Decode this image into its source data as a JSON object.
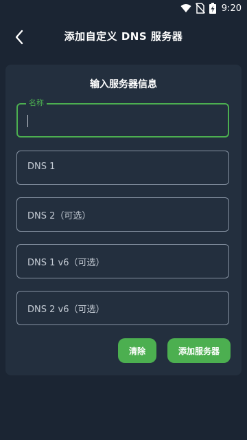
{
  "status_bar": {
    "time": "9:20",
    "icons": [
      "wifi-icon",
      "no-sim-icon",
      "battery-charging-icon"
    ]
  },
  "app_bar": {
    "title": "添加自定义 DNS 服务器",
    "back_icon": "back-arrow-icon"
  },
  "form": {
    "title": "输入服务器信息",
    "name_field": {
      "label": "名称",
      "value": ""
    },
    "dns1_field": {
      "placeholder": "DNS 1"
    },
    "dns2_field": {
      "placeholder": "DNS 2（可选）"
    },
    "dns1v6_field": {
      "placeholder": "DNS 1 v6（可选）"
    },
    "dns2v6_field": {
      "placeholder": "DNS 2 v6（可选）"
    },
    "clear_button": "清除",
    "add_button": "添加服务器"
  },
  "colors": {
    "background": "#1b2533",
    "card": "#232f3e",
    "accent": "#4caf50",
    "border": "#8793a3"
  }
}
